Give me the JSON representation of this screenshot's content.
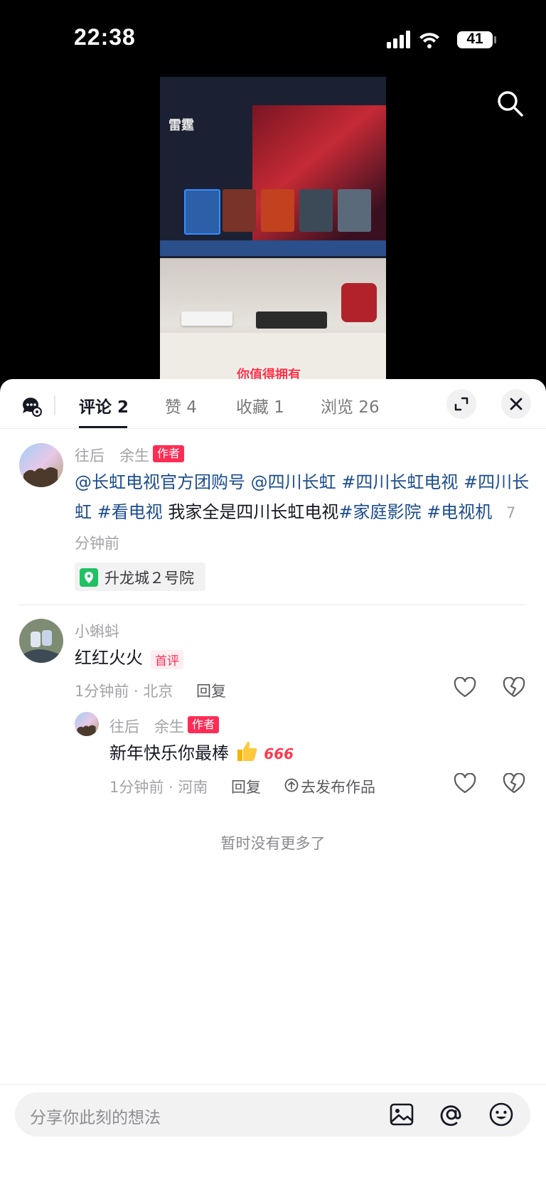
{
  "status_bar": {
    "time": "22:38",
    "battery": "41"
  },
  "video": {
    "caption": "你值得拥有",
    "tv_title": "雷霆"
  },
  "tabs": [
    {
      "label": "评论 2",
      "active": true
    },
    {
      "label": "赞 4",
      "active": false
    },
    {
      "label": "收藏 1",
      "active": false
    },
    {
      "label": "浏览 26",
      "active": false
    }
  ],
  "post": {
    "author": "往后　余生",
    "author_tag": "作者",
    "text_parts": [
      {
        "t": "@长虹电视官方团购号 @四川长虹 #四川长虹电视 #四川长虹 #看电视",
        "hl": true
      },
      {
        "t": " 我家全是四川长虹电视",
        "hl": false
      },
      {
        "t": "#家庭影院 #电视机",
        "hl": true
      }
    ],
    "time": "7分钟前",
    "location": "升龙城２号院"
  },
  "comments": [
    {
      "user": "小蝌蚪",
      "text": "红红火火",
      "badge": "首评",
      "meta": "1分钟前 · 北京",
      "reply_label": "回复",
      "replies": [
        {
          "user": "往后　余生",
          "tag": "作者",
          "text": "新年快乐你最棒",
          "emoji_text": "666",
          "meta": "1分钟前 · 河南",
          "reply_label": "回复",
          "publish_label": "去发布作品"
        }
      ]
    }
  ],
  "no_more": "暂时没有更多了",
  "input": {
    "placeholder": "分享你此刻的想法"
  },
  "colors": {
    "accent": "#fe2c55",
    "link": "#1d4d8e"
  }
}
